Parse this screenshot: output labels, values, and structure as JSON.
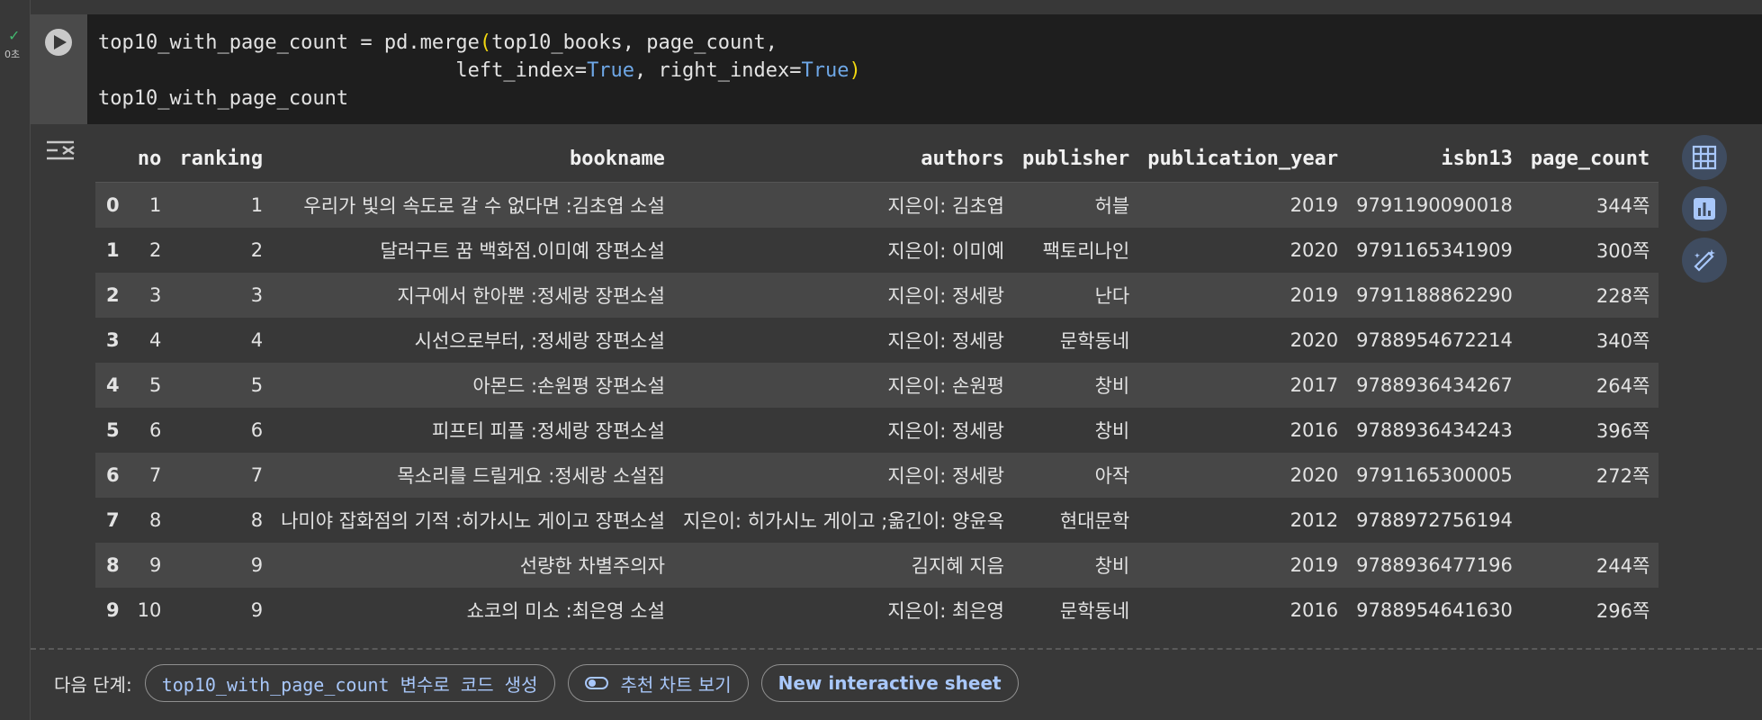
{
  "cell": {
    "exec_time": "0초",
    "code": {
      "line1_a": "top10_with_page_count = pd.merge",
      "line1_b": "(",
      "line1_c": "top10_books, page_count,",
      "line2_a": "                              left_index=",
      "line2_b": "True",
      "line2_c": ", right_index=",
      "line2_d": "True",
      "line2_e": ")",
      "line3": "top10_with_page_count"
    }
  },
  "table": {
    "columns": [
      "",
      "no",
      "ranking",
      "bookname",
      "authors",
      "publisher",
      "publication_year",
      "isbn13",
      "page_count"
    ],
    "rows": [
      [
        "0",
        "1",
        "1",
        "우리가 빛의 속도로 갈 수 없다면 :김초엽 소설",
        "지은이: 김초엽",
        "허블",
        "2019",
        "9791190090018",
        "344쪽"
      ],
      [
        "1",
        "2",
        "2",
        "달러구트 꿈 백화점.이미예 장편소설",
        "지은이: 이미예",
        "팩토리나인",
        "2020",
        "9791165341909",
        "300쪽"
      ],
      [
        "2",
        "3",
        "3",
        "지구에서 한아뿐 :정세랑 장편소설",
        "지은이: 정세랑",
        "난다",
        "2019",
        "9791188862290",
        "228쪽"
      ],
      [
        "3",
        "4",
        "4",
        "시선으로부터, :정세랑 장편소설",
        "지은이: 정세랑",
        "문학동네",
        "2020",
        "9788954672214",
        "340쪽"
      ],
      [
        "4",
        "5",
        "5",
        "아몬드 :손원평 장편소설",
        "지은이: 손원평",
        "창비",
        "2017",
        "9788936434267",
        "264쪽"
      ],
      [
        "5",
        "6",
        "6",
        "피프티 피플 :정세랑 장편소설",
        "지은이: 정세랑",
        "창비",
        "2016",
        "9788936434243",
        "396쪽"
      ],
      [
        "6",
        "7",
        "7",
        "목소리를 드릴게요 :정세랑 소설집",
        "지은이: 정세랑",
        "아작",
        "2020",
        "9791165300005",
        "272쪽"
      ],
      [
        "7",
        "8",
        "8",
        "나미야 잡화점의 기적 :히가시노 게이고 장편소설",
        "지은이: 히가시노 게이고 ;옮긴이: 양윤옥",
        "현대문학",
        "2012",
        "9788972756194",
        ""
      ],
      [
        "8",
        "9",
        "9",
        "선량한 차별주의자",
        "김지혜 지음",
        "창비",
        "2019",
        "9788936477196",
        "244쪽"
      ],
      [
        "9",
        "10",
        "9",
        "쇼코의 미소 :최은영 소설",
        "지은이: 최은영",
        "문학동네",
        "2016",
        "9788954641630",
        "296쪽"
      ]
    ]
  },
  "side_icons": [
    "table-icon",
    "chart-icon",
    "magic-wand-icon"
  ],
  "next_steps": {
    "label": "다음 단계:",
    "chip1": "top10_with_page_count 변수로 코드 생성",
    "chip2": "추천 차트 보기",
    "chip3": "New interactive sheet"
  },
  "colors": {
    "background": "#383838",
    "code_bg": "#1e1e1e",
    "accent": "#a8c7fa",
    "keyword": "#6ea7e6",
    "paren": "#f1d710",
    "success": "#43b86f"
  }
}
